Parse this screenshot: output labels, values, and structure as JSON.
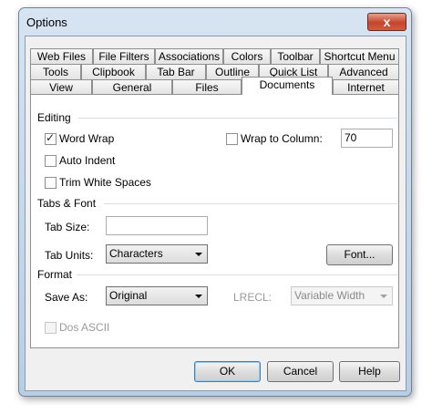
{
  "window": {
    "title": "Options",
    "close": "x"
  },
  "tabs": {
    "row1": [
      "Web Files",
      "File Filters",
      "Associations",
      "Colors",
      "Toolbar",
      "Shortcut Menu"
    ],
    "row2": [
      "Tools",
      "Clipbook",
      "Tab Bar",
      "Outline",
      "Quick List",
      "Advanced"
    ],
    "row3": [
      "View",
      "General",
      "Files",
      "Documents",
      "Internet"
    ],
    "active": "Documents"
  },
  "editing": {
    "heading": "Editing",
    "word_wrap": {
      "label": "Word Wrap",
      "checked": true
    },
    "wrap_to_column": {
      "label": "Wrap to Column:",
      "checked": false,
      "value": "70"
    },
    "auto_indent": {
      "label": "Auto Indent",
      "checked": false
    },
    "trim_white_spaces": {
      "label": "Trim White Spaces",
      "checked": false
    }
  },
  "tabs_font": {
    "heading": "Tabs & Font",
    "tab_size_label": "Tab Size:",
    "tab_size_value": "",
    "tab_units_label": "Tab Units:",
    "tab_units_value": "Characters",
    "font_button": "Font..."
  },
  "format": {
    "heading": "Format",
    "save_as_label": "Save As:",
    "save_as_value": "Original",
    "lrecl_label": "LRECL:",
    "lrecl_value": "Variable Width",
    "dos_ascii_label": "Dos ASCII"
  },
  "buttons": {
    "ok": "OK",
    "cancel": "Cancel",
    "help": "Help"
  }
}
